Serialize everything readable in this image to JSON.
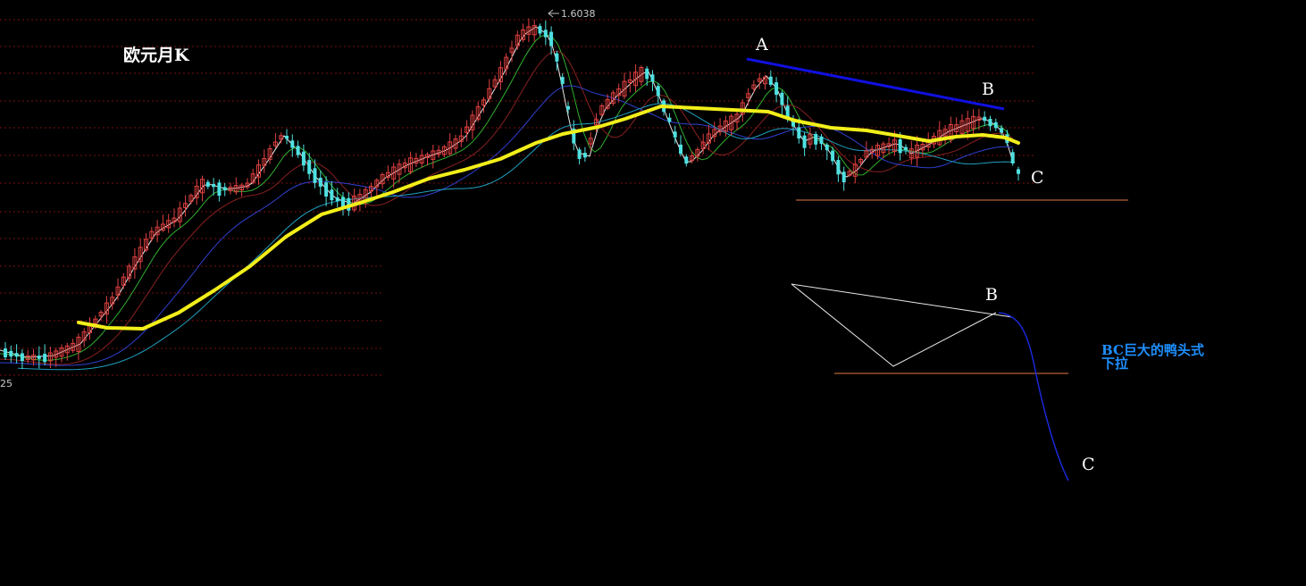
{
  "colors": {
    "background": "#000000",
    "grid": "#7a1010",
    "candle_up": "#e04040",
    "candle_down": "#4fe0e0",
    "ma_thick": "#f2ee1a",
    "ma_blue": "#3040d0",
    "ma_cyan": "#20a0c0",
    "ma_green": "#30b030",
    "ma_white": "#e8e8e8",
    "trendline": "#1010e0",
    "support": "#e07a40",
    "annotation_text": "#1e90ff",
    "label": "#ffffff"
  },
  "chart_data": {
    "type": "candlestick",
    "title": "欧元月K",
    "grid": true,
    "peak_label": "1.6038",
    "left_tick_label": "25",
    "point_labels": [
      "A",
      "B",
      "C"
    ],
    "inset_point_labels": [
      "B",
      "C"
    ],
    "annotation": [
      "BC巨大的鸭头式",
      "下拉"
    ]
  },
  "icons": {
    "peak_marker": "arrow-left-icon"
  }
}
